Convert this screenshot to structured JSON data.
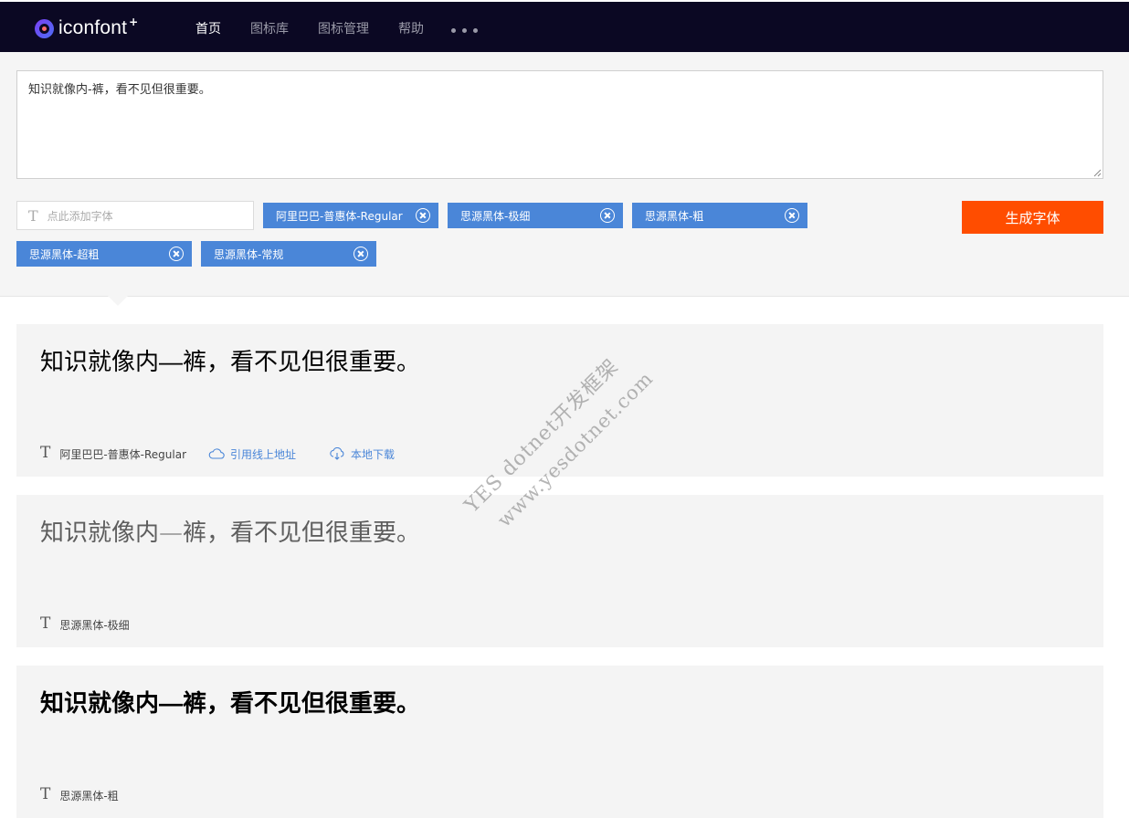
{
  "app": {
    "logo_text": "iconfont",
    "logo_plus": "+"
  },
  "nav": {
    "items": [
      "首页",
      "图标库",
      "图标管理",
      "帮助"
    ],
    "active_index": 0
  },
  "editor": {
    "text": "知识就像内-裤，看不见但很重要。"
  },
  "font_picker": {
    "placeholder": "点此添加字体"
  },
  "selected_fonts": [
    "阿里巴巴-普惠体-Regular",
    "思源黑体-极细",
    "思源黑体-粗",
    "思源黑体-超粗",
    "思源黑体-常规"
  ],
  "generate_label": "生成字体",
  "previews": [
    {
      "sample": "知识就像内—裤，看不见但很重要。",
      "font_name": "阿里巴巴-普惠体-Regular",
      "online_link": "引用线上地址",
      "download_link": "本地下载"
    },
    {
      "sample": "知识就像内—裤，看不见但很重要。",
      "font_name": "思源黑体-极细"
    },
    {
      "sample": "知识就像内—裤，看不见但很重要。",
      "font_name": "思源黑体-粗"
    }
  ],
  "watermark": {
    "line1": "YES dotnet开发框架",
    "line2": "www.yesdotnet.com"
  },
  "colors": {
    "nav_bg": "#0b0823",
    "tag_bg": "#4a86d8",
    "primary_button": "#ff4d00",
    "card_bg": "#f4f4f4"
  }
}
